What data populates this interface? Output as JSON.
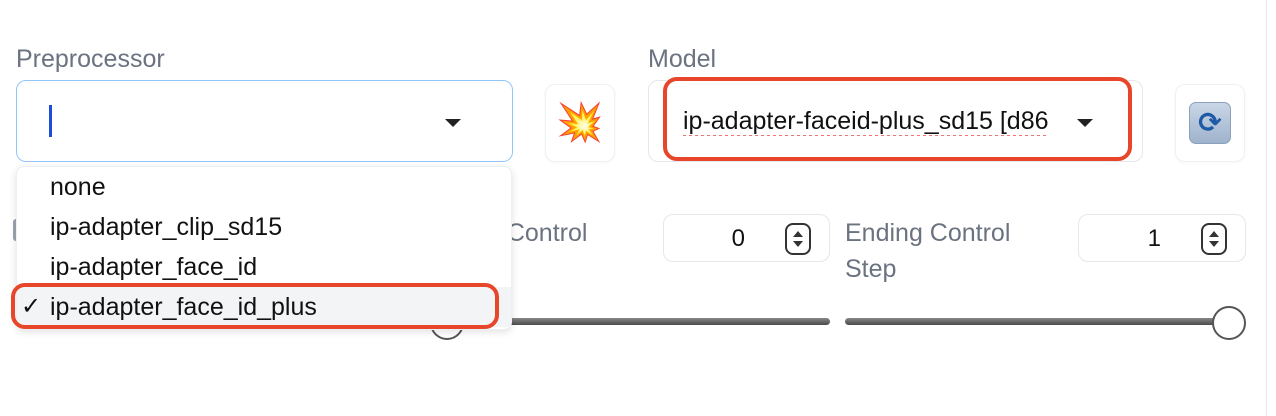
{
  "preprocessor": {
    "label": "Preprocessor",
    "value": "",
    "options": [
      "none",
      "ip-adapter_clip_sd15",
      "ip-adapter_face_id",
      "ip-adapter_face_id_plus"
    ],
    "selected_index": 3,
    "check_mark": "✓"
  },
  "run_preprocessor_button": {
    "icon": "collision-icon",
    "glyph": "💥"
  },
  "model": {
    "label": "Model",
    "value": "ip-adapter-faceid-plus_sd15 [d86"
  },
  "refresh_button": {
    "icon": "refresh-icon",
    "glyph": "⟳"
  },
  "starting_control_step": {
    "label": "g Control",
    "value": "0",
    "level": 0
  },
  "ending_control_step": {
    "label": "Ending Control Step",
    "value": "1",
    "level": 1
  },
  "colors": {
    "highlight": "#e8462a",
    "focus_border": "#93c5fd",
    "caret": "#1d4ed8"
  }
}
